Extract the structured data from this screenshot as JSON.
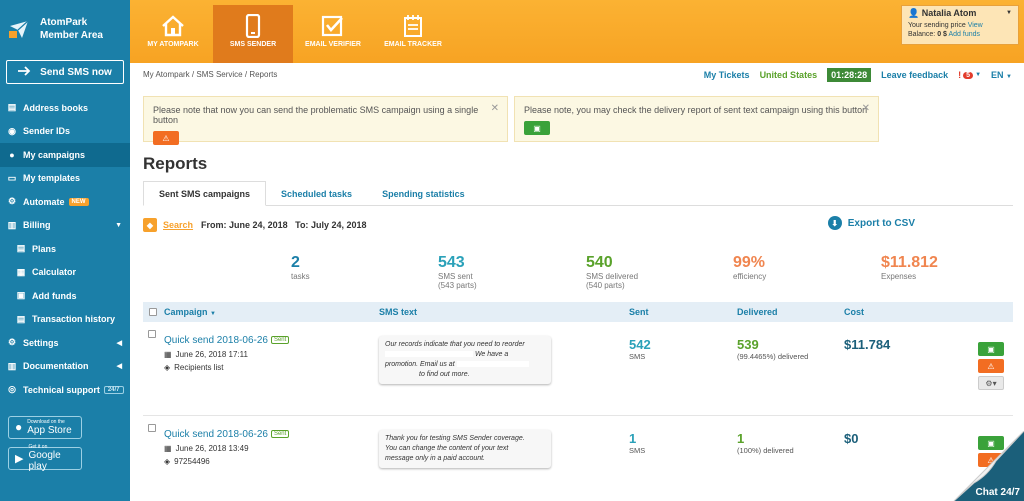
{
  "brand": {
    "line1": "AtomPark",
    "line2": "Member Area"
  },
  "sidebar": {
    "send_label": "Send SMS now",
    "items": [
      {
        "label": "Address books"
      },
      {
        "label": "Sender IDs"
      },
      {
        "label": "My campaigns"
      },
      {
        "label": "My templates"
      },
      {
        "label": "Automate",
        "badge": "NEW"
      },
      {
        "label": "Billing"
      },
      {
        "label": "Plans"
      },
      {
        "label": "Calculator"
      },
      {
        "label": "Add funds"
      },
      {
        "label": "Transaction history"
      },
      {
        "label": "Settings"
      },
      {
        "label": "Documentation"
      },
      {
        "label": "Technical support",
        "badge": "24/7"
      }
    ],
    "stores": [
      {
        "small": "Download on the",
        "big": "App Store"
      },
      {
        "small": "Get it on",
        "big": "Google play"
      }
    ]
  },
  "topbar": {
    "tabs": [
      {
        "label": "MY ATOMPARK",
        "icon": "home-icon"
      },
      {
        "label": "SMS SENDER",
        "icon": "phone-icon"
      },
      {
        "label": "EMAIL VERIFIER",
        "icon": "checkbox-icon"
      },
      {
        "label": "EMAIL TRACKER",
        "icon": "tracker-icon"
      }
    ],
    "user": {
      "name": "Natalia Atom",
      "price_label": "Your sending price",
      "price_link": "View",
      "balance_label": "Balance:",
      "balance_value": "0 $",
      "add_funds": "Add funds"
    }
  },
  "breadcrumb": {
    "items": [
      "My Atompark",
      "SMS Service",
      "Reports"
    ],
    "sep": "/"
  },
  "topright": {
    "tickets": "My Tickets",
    "country": "United States",
    "timer": "01:28:28",
    "feedback": "Leave feedback",
    "alert_count": "5",
    "lang": "EN"
  },
  "notices": [
    {
      "text": "Please note that now you can send the problematic SMS campaign using a single button"
    },
    {
      "text": "Please note, you may check the delivery report of sent text campaign using this button"
    }
  ],
  "page_title": "Reports",
  "tabs": [
    "Sent SMS campaigns",
    "Scheduled tasks",
    "Spending statistics"
  ],
  "search": {
    "label": "Search",
    "from_label": "From:",
    "from_value": "June 24, 2018",
    "to_label": "To:",
    "to_value": "July 24, 2018",
    "export": "Export to CSV"
  },
  "stats": [
    {
      "value": "2",
      "label": "tasks",
      "sub": "",
      "color": "#1b7fa8"
    },
    {
      "value": "543",
      "label": "SMS sent",
      "sub": "(543 parts)",
      "color": "#2aa1b9"
    },
    {
      "value": "540",
      "label": "SMS delivered",
      "sub": "(540 parts)",
      "color": "#5aa22b"
    },
    {
      "value": "99%",
      "label": "efficiency",
      "sub": "",
      "color": "#f0854f"
    },
    {
      "value": "$11.812",
      "label": "Expenses",
      "sub": "",
      "color": "#f0854f"
    }
  ],
  "table": {
    "headers": [
      "Campaign",
      "SMS text",
      "Sent",
      "Delivered",
      "Cost"
    ],
    "rows": [
      {
        "title": "Quick send 2018-06-26",
        "tag": "Sent",
        "date": "June 26, 2018 17:11",
        "recipients": "Recipients list",
        "text1": "Our records indicate that you need to reorder",
        "text2": "We have a",
        "text3": "promotion. Email us at",
        "text4": "to find out more.",
        "sent": "542",
        "sent_sub": "SMS",
        "delivered": "539",
        "delivered_sub": "(99.4465%) delivered",
        "cost": "$11.784"
      },
      {
        "title": "Quick send 2018-06-26",
        "tag": "Sent",
        "date": "June 26, 2018 13:49",
        "recipients": "97254496",
        "text1": "Thank you for testing SMS Sender coverage.",
        "text2": "You can change the content of your text",
        "text3": "message only in a paid account.",
        "text4": "",
        "sent": "1",
        "sent_sub": "SMS",
        "delivered": "1",
        "delivered_sub": "(100%) delivered",
        "cost": "$0"
      }
    ]
  },
  "chat": {
    "label": "Chat 24/7"
  }
}
